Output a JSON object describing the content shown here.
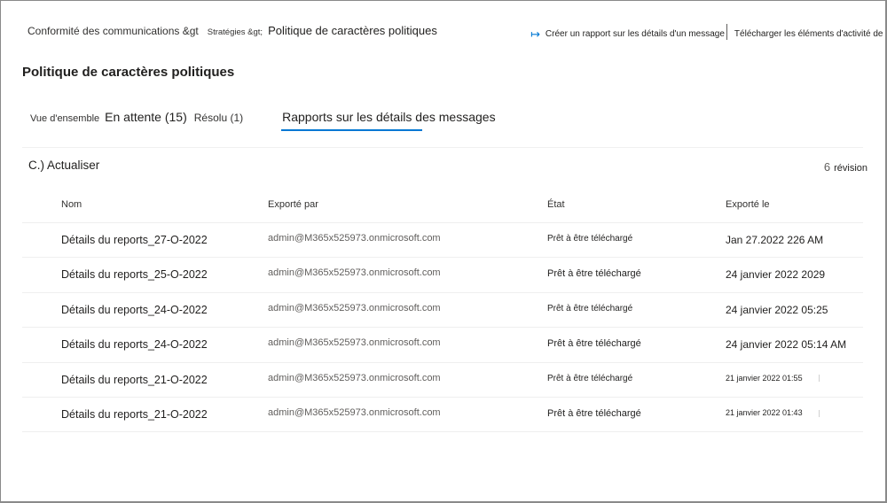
{
  "breadcrumb": {
    "item1": "Conformité des communications &gt",
    "item2": "Stratégies &gt;",
    "item3": "Politique de caractères politiques"
  },
  "actions": {
    "create_report": "Créer un rapport sur les détails d'un message",
    "download": "Télécharger les éléments d'activité de"
  },
  "page": {
    "title": "Politique de caractères politiques"
  },
  "tabs": {
    "overview": "Vue d'ensemble",
    "pending": "En attente (15)",
    "resolved": "Résolu (1)",
    "reports": "Rapports sur les détails des messages"
  },
  "toolbar": {
    "refresh": "C.) Actualiser",
    "count": "6",
    "count_label": "révision"
  },
  "table": {
    "headers": {
      "name": "Nom",
      "exported_by": "Exporté par",
      "state": "État",
      "exported_on": "Exporté le"
    },
    "rows": [
      {
        "name": "Détails du reports_27-O-2022",
        "by": "admin@M365x525973.onmicrosoft.com",
        "state": "Prêt à être téléchargé",
        "date": "Jan 27.2022 226 AM"
      },
      {
        "name": "Détails du reports_25-O-2022",
        "by": "admin@M365x525973.onmicrosoft.com",
        "state": "Prêt à être téléchargé",
        "date": "24 janvier 2022 2029"
      },
      {
        "name": "Détails du reports_24-O-2022",
        "by": "admin@M365x525973.onmicrosoft.com",
        "state": "Prêt à être téléchargé",
        "date": "24 janvier 2022 05:25"
      },
      {
        "name": "Détails du reports_24-O-2022",
        "by": "admin@M365x525973.onmicrosoft.com",
        "state": "Prêt à être téléchargé",
        "date": "24 janvier 2022 05:14 AM"
      },
      {
        "name": "Détails du reports_21-O-2022",
        "by": "admin@M365x525973.onmicrosoft.com",
        "state": "Prêt à être téléchargé",
        "date": "21 janvier 2022 01:55"
      },
      {
        "name": "Détails du reports_21-O-2022",
        "by": "admin@M365x525973.onmicrosoft.com",
        "state": "Prêt à être téléchargé",
        "date": "21 janvier 2022 01:43"
      }
    ]
  },
  "colors": {
    "accent": "#0078d4",
    "text": "#201f1e",
    "muted": "#605e5c"
  }
}
